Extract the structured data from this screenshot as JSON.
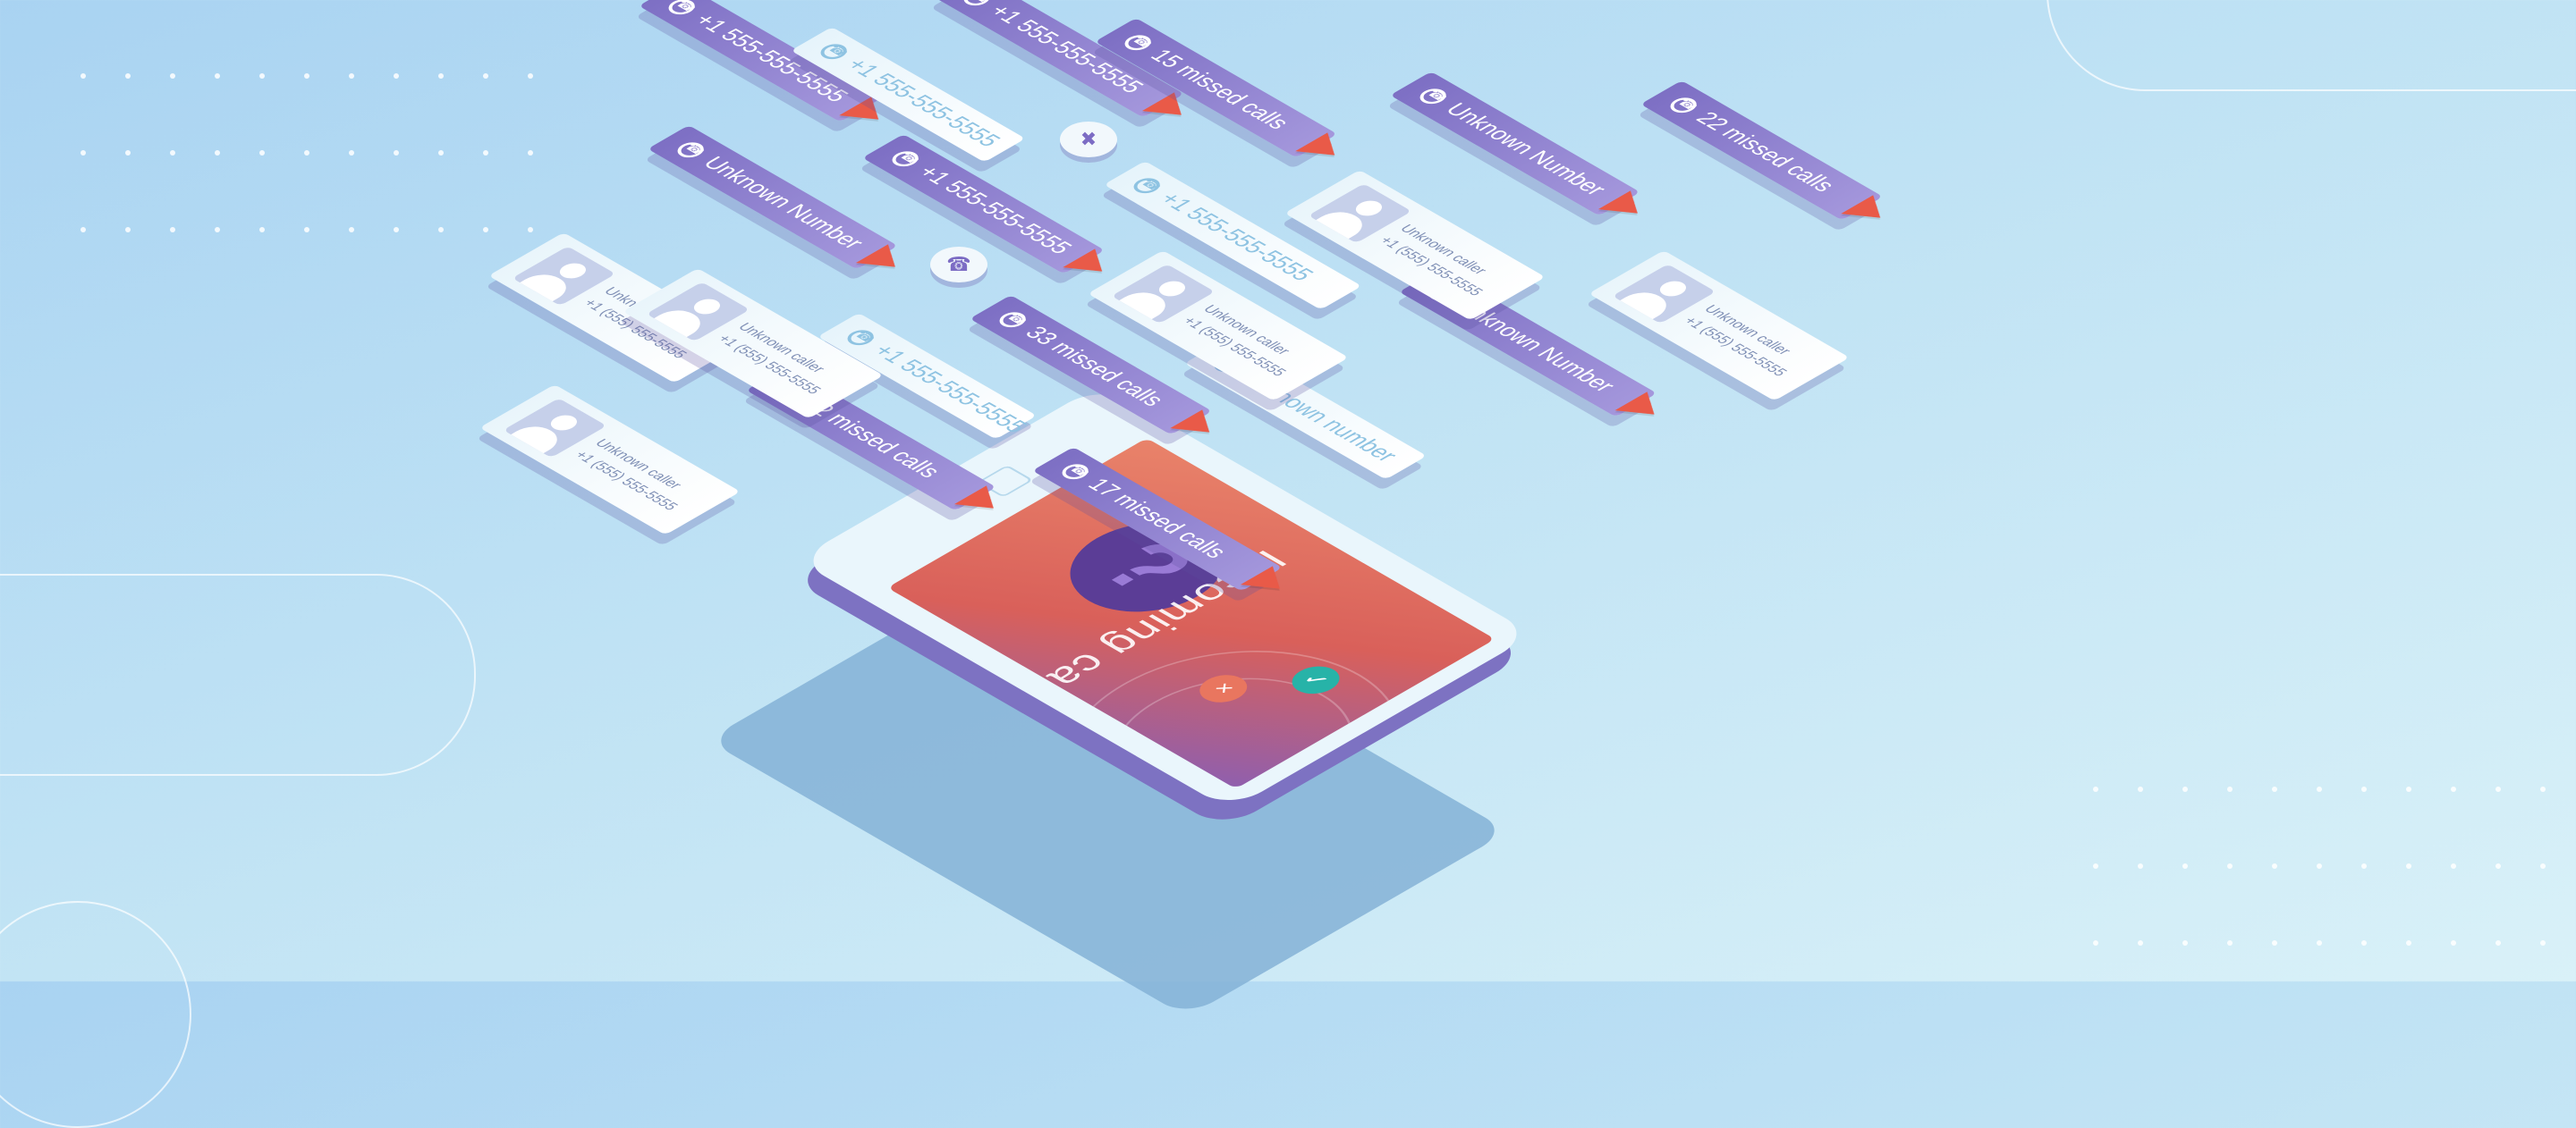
{
  "illustration": {
    "phone": {
      "incoming_label": "Incoming call",
      "question_mark": "?",
      "decline_glyph": "×",
      "accept_glyph": "✓"
    },
    "cards": [
      {
        "style": "purple",
        "text": "+1 555-555-5555",
        "flag": true
      },
      {
        "style": "light",
        "text": "+1 555-555-5555",
        "flag": false
      },
      {
        "style": "purple",
        "text": "+1 555-555-5555",
        "flag": true
      },
      {
        "style": "purple",
        "text": "15 missed calls",
        "flag": true
      },
      {
        "style": "purple",
        "text": "Unknown Number",
        "flag": true
      },
      {
        "style": "purple",
        "text": "+1 555-555-5555",
        "flag": true
      },
      {
        "style": "light",
        "text": "+1 555-555-5555",
        "flag": false
      },
      {
        "style": "purple",
        "text": "Unknown Number",
        "flag": true
      },
      {
        "style": "purple",
        "text": "22 missed calls",
        "flag": true
      },
      {
        "style": "purple",
        "text": "33 missed calls",
        "flag": true
      },
      {
        "style": "light",
        "text": "+1 555-555-5555",
        "flag": false
      },
      {
        "style": "purple",
        "text": "Unknown Number",
        "flag": true
      },
      {
        "style": "light",
        "text": "Unknown number",
        "flag": false
      },
      {
        "style": "purple",
        "text": "22 missed calls",
        "flag": true
      },
      {
        "style": "purple",
        "text": "17 missed calls",
        "flag": true
      }
    ],
    "contacts": [
      {
        "name": "Unknown caller",
        "number": "+1 (555) 555-5555"
      },
      {
        "name": "Unknown caller",
        "number": "+1 (555) 555-5555"
      },
      {
        "name": "Unknown caller",
        "number": "+1 (555) 555-5555"
      },
      {
        "name": "Unknown caller",
        "number": "+1 (555) 555-5555"
      },
      {
        "name": "Unknown caller",
        "number": "+1 (555) 555-5555"
      },
      {
        "name": "Unknown caller",
        "number": "+1 (555) 555-5555"
      }
    ],
    "colors": {
      "card_purple": "#8b7fd0",
      "flag": "#e95a48",
      "screen_top": "#e9836a",
      "question_bubble": "#5b3d96",
      "accept": "#27b3a8",
      "background": "#bfe2f4"
    },
    "icons": [
      "phone-icon",
      "shuffle-icon",
      "missed-call-icon",
      "flag-icon",
      "avatar-icon"
    ]
  }
}
